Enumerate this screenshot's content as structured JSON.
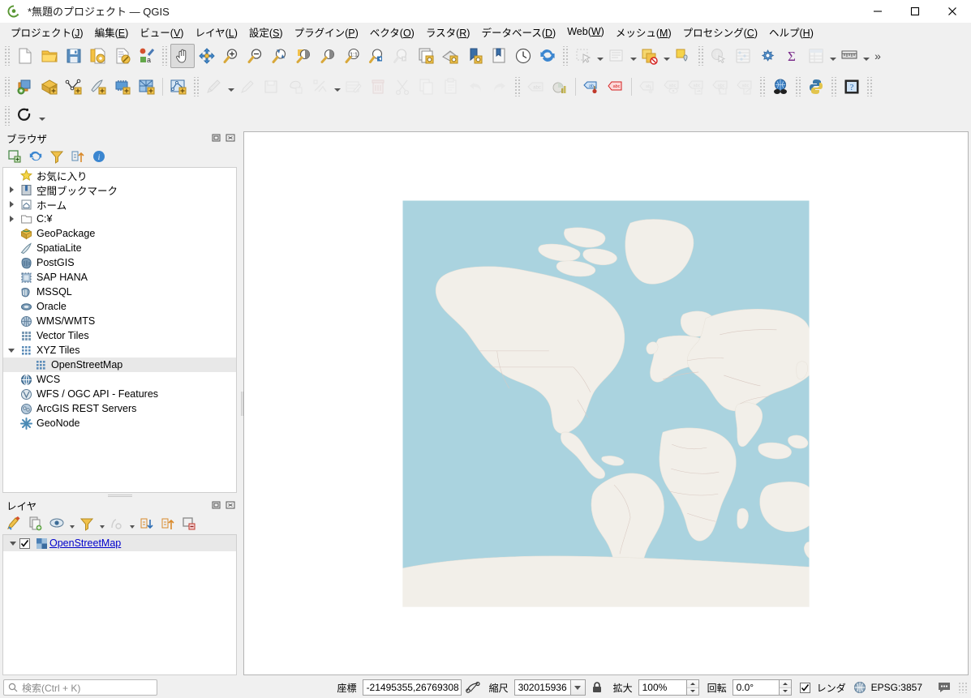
{
  "window": {
    "title": "*無題のプロジェクト — QGIS",
    "logo_icon": "qgis-logo-icon",
    "minimize_label": "—",
    "maximize_label": "□",
    "close_label": "✕"
  },
  "menubar": {
    "items": [
      {
        "label": "プロジェクト(J)",
        "name": "menu-project"
      },
      {
        "label": "編集(E)",
        "name": "menu-edit"
      },
      {
        "label": "ビュー(V)",
        "name": "menu-view"
      },
      {
        "label": "レイヤ(L)",
        "name": "menu-layer"
      },
      {
        "label": "設定(S)",
        "name": "menu-settings"
      },
      {
        "label": "プラグイン(P)",
        "name": "menu-plugins"
      },
      {
        "label": "ベクタ(O)",
        "name": "menu-vector"
      },
      {
        "label": "ラスタ(R)",
        "name": "menu-raster"
      },
      {
        "label": "データベース(D)",
        "name": "menu-database"
      },
      {
        "label": "Web(W)",
        "name": "menu-web"
      },
      {
        "label": "メッシュ(M)",
        "name": "menu-mesh"
      },
      {
        "label": "プロセシング(C)",
        "name": "menu-processing"
      },
      {
        "label": "ヘルプ(H)",
        "name": "menu-help"
      }
    ]
  },
  "toolbars": {
    "row1": [
      {
        "icon": "new-project-icon",
        "name": "new-project-button"
      },
      {
        "icon": "open-project-icon",
        "name": "open-project-button"
      },
      {
        "icon": "save-project-icon",
        "name": "save-project-button"
      },
      {
        "icon": "save-project-as-icon",
        "name": "save-project-as-button"
      },
      {
        "icon": "new-print-layout-icon",
        "name": "new-print-layout-button"
      },
      {
        "icon": "style-manager-icon",
        "name": "style-manager-button"
      },
      {
        "icon": "pan-map-icon",
        "name": "pan-map-button",
        "active": true
      },
      {
        "icon": "pan-to-selection-icon",
        "name": "pan-to-selection-button"
      },
      {
        "icon": "zoom-in-icon",
        "name": "zoom-in-button"
      },
      {
        "icon": "zoom-out-icon",
        "name": "zoom-out-button"
      },
      {
        "icon": "zoom-full-icon",
        "name": "zoom-full-button"
      },
      {
        "icon": "zoom-to-selection-icon",
        "name": "zoom-to-selection-button"
      },
      {
        "icon": "zoom-to-layer-icon",
        "name": "zoom-to-layer-button"
      },
      {
        "icon": "zoom-native-icon",
        "name": "zoom-native-button"
      },
      {
        "icon": "zoom-last-icon",
        "name": "zoom-last-button"
      },
      {
        "icon": "zoom-next-icon",
        "name": "zoom-next-button",
        "disabled": true
      },
      {
        "icon": "new-map-view-icon",
        "name": "new-map-view-button"
      },
      {
        "icon": "new-3d-map-view-icon",
        "name": "new-3d-map-view-button"
      },
      {
        "icon": "new-bookmark-icon",
        "name": "new-bookmark-button"
      },
      {
        "icon": "show-bookmarks-icon",
        "name": "show-bookmarks-button"
      },
      {
        "icon": "temporal-controller-icon",
        "name": "temporal-controller-button"
      },
      {
        "icon": "refresh-icon",
        "name": "refresh-button"
      },
      {
        "icon": "select-features-icon",
        "name": "select-features-button",
        "disabled": true
      },
      {
        "icon": "select-value-icon",
        "name": "select-by-value-button",
        "disabled": true
      },
      {
        "icon": "deselect-features-icon",
        "name": "deselect-features-button"
      },
      {
        "icon": "identify-features-icon",
        "name": "identify-features-button",
        "disabled": true
      },
      {
        "icon": "statistical-summary-icon",
        "name": "statistical-summary-button",
        "disabled": true
      },
      {
        "icon": "processing-toolbox-icon",
        "name": "processing-toolbox-button"
      },
      {
        "icon": "field-calculator-icon",
        "name": "field-calculator-button"
      },
      {
        "icon": "attribute-table-icon",
        "name": "open-attribute-table-button",
        "disabled": true
      },
      {
        "icon": "measure-line-icon",
        "name": "measure-button"
      }
    ],
    "row2": [
      {
        "icon": "add-layer-icon",
        "name": "open-data-source-manager-button"
      },
      {
        "icon": "add-raster-layer-icon",
        "name": "add-raster-layer-button"
      },
      {
        "icon": "add-vector-layer-icon",
        "name": "add-vector-layer-button"
      },
      {
        "icon": "add-delimited-text-icon",
        "name": "add-delimited-text-layer-button"
      },
      {
        "icon": "add-mesh-layer-icon",
        "name": "add-mesh-layer-button"
      },
      {
        "icon": "add-virtual-layer-icon",
        "name": "add-virtual-layer-button"
      },
      {
        "icon": "new-shapefile-icon",
        "name": "new-shapefile-layer-button"
      },
      {
        "icon": "current-edits-icon",
        "name": "current-edits-button",
        "disabled": true
      },
      {
        "icon": "toggle-editing-icon",
        "name": "toggle-editing-button",
        "disabled": true
      },
      {
        "icon": "save-layer-edits-icon",
        "name": "save-layer-edits-button",
        "disabled": true
      },
      {
        "icon": "add-feature-icon",
        "name": "add-feature-button",
        "disabled": true
      },
      {
        "icon": "vertex-tool-icon",
        "name": "vertex-tool-button",
        "disabled": true
      },
      {
        "icon": "modify-attributes-icon",
        "name": "modify-attributes-button",
        "disabled": true
      },
      {
        "icon": "delete-selected-icon",
        "name": "delete-selected-button",
        "disabled": true
      },
      {
        "icon": "cut-features-icon",
        "name": "cut-features-button",
        "disabled": true
      },
      {
        "icon": "copy-features-icon",
        "name": "copy-features-button",
        "disabled": true
      },
      {
        "icon": "paste-features-icon",
        "name": "paste-features-button",
        "disabled": true
      },
      {
        "icon": "undo-icon",
        "name": "undo-button",
        "disabled": true
      },
      {
        "icon": "redo-icon",
        "name": "redo-button",
        "disabled": true
      },
      {
        "icon": "label-icon",
        "name": "layer-labeling-button",
        "disabled": true
      },
      {
        "icon": "diagram-icon",
        "name": "layer-diagram-button"
      },
      {
        "icon": "pin-labels-icon",
        "name": "pin-labels-button"
      },
      {
        "icon": "highlight-labels-icon",
        "name": "highlight-labels-button"
      },
      {
        "icon": "move-label-icon",
        "name": "move-label-button",
        "disabled": true
      },
      {
        "icon": "show-hide-labels-icon",
        "name": "show-hide-labels-button",
        "disabled": true
      },
      {
        "icon": "rotate-label-icon",
        "name": "rotate-label-button",
        "disabled": true
      },
      {
        "icon": "change-label-icon",
        "name": "change-label-button",
        "disabled": true
      },
      {
        "icon": "edit-label-icon",
        "name": "edit-label-button",
        "disabled": true
      },
      {
        "icon": "metasearch-icon",
        "name": "metasearch-button"
      },
      {
        "icon": "python-console-icon",
        "name": "python-console-button"
      },
      {
        "icon": "help-icon",
        "name": "help-button"
      }
    ],
    "row3": [
      {
        "icon": "georeferencer-icon",
        "name": "georeferencer-button"
      }
    ]
  },
  "browser_panel": {
    "title": "ブラウザ",
    "undock_icon": "undock-icon",
    "close_icon": "close-icon",
    "toolbar": [
      {
        "icon": "add-layer-icon",
        "name": "add-selected-layers-button"
      },
      {
        "icon": "refresh-icon",
        "name": "refresh-browser-button"
      },
      {
        "icon": "filter-icon",
        "name": "filter-browser-button"
      },
      {
        "icon": "collapse-all-icon",
        "name": "collapse-all-button"
      },
      {
        "icon": "info-icon",
        "name": "show-properties-button"
      }
    ],
    "items": [
      {
        "label": "お気に入り",
        "icon": "star-icon",
        "twist": "none",
        "indent": 0
      },
      {
        "label": "空間ブックマーク",
        "icon": "bookmark-icon",
        "twist": "right",
        "indent": 0
      },
      {
        "label": "ホーム",
        "icon": "home-icon",
        "twist": "right",
        "indent": 0
      },
      {
        "label": "C:¥",
        "icon": "folder-icon",
        "twist": "right",
        "indent": 0
      },
      {
        "label": "GeoPackage",
        "icon": "geopackage-icon",
        "twist": "none",
        "indent": 0
      },
      {
        "label": "SpatiaLite",
        "icon": "spatialite-icon",
        "twist": "none",
        "indent": 0
      },
      {
        "label": "PostGIS",
        "icon": "postgis-icon",
        "twist": "none",
        "indent": 0
      },
      {
        "label": "SAP HANA",
        "icon": "saphana-icon",
        "twist": "none",
        "indent": 0
      },
      {
        "label": "MSSQL",
        "icon": "mssql-icon",
        "twist": "none",
        "indent": 0
      },
      {
        "label": "Oracle",
        "icon": "oracle-icon",
        "twist": "none",
        "indent": 0
      },
      {
        "label": "WMS/WMTS",
        "icon": "wms-icon",
        "twist": "none",
        "indent": 0
      },
      {
        "label": "Vector Tiles",
        "icon": "vectortiles-icon",
        "twist": "none",
        "indent": 0
      },
      {
        "label": "XYZ Tiles",
        "icon": "xyztiles-icon",
        "twist": "down",
        "indent": 0
      },
      {
        "label": "OpenStreetMap",
        "icon": "xyztiles-icon",
        "twist": "none",
        "indent": 1,
        "selected": true
      },
      {
        "label": "WCS",
        "icon": "wcs-icon",
        "twist": "none",
        "indent": 0
      },
      {
        "label": "WFS / OGC API - Features",
        "icon": "wfs-icon",
        "twist": "none",
        "indent": 0
      },
      {
        "label": "ArcGIS REST Servers",
        "icon": "arcgis-icon",
        "twist": "none",
        "indent": 0
      },
      {
        "label": "GeoNode",
        "icon": "geonode-icon",
        "twist": "none",
        "indent": 0
      }
    ]
  },
  "layers_panel": {
    "title": "レイヤ",
    "undock_icon": "undock-icon",
    "close_icon": "close-icon",
    "toolbar": [
      {
        "icon": "open-layer-styling-icon",
        "name": "open-layer-styling-button"
      },
      {
        "icon": "add-group-icon",
        "name": "add-group-button"
      },
      {
        "icon": "manage-visibility-icon",
        "name": "manage-map-themes-button"
      },
      {
        "icon": "filter-legend-icon",
        "name": "filter-legend-button"
      },
      {
        "icon": "edit-filter-icon",
        "name": "filter-legend-expression-button",
        "disabled": true
      },
      {
        "icon": "expand-all-icon",
        "name": "expand-all-button"
      },
      {
        "icon": "collapse-all-icon",
        "name": "collapse-all-button"
      },
      {
        "icon": "remove-layer-icon",
        "name": "remove-layer-button"
      }
    ],
    "layers": [
      {
        "label": "OpenStreetMap",
        "checked": true,
        "icon": "raster-layer-icon",
        "twist": "down"
      }
    ]
  },
  "statusbar": {
    "search_placeholder": "検索(Ctrl + K)",
    "search_icon": "search-icon",
    "coordinate_label": "座標",
    "coordinate_value": "-21495355,26769308",
    "toggle_extents_icon": "toggle-extents-icon",
    "scale_label": "縮尺",
    "scale_value": "302015936",
    "lock_icon": "lock-icon",
    "magnifier_label": "拡大",
    "magnifier_value": "100%",
    "rotation_label": "回転",
    "rotation_value": "0.0°",
    "render_label": "レンダ",
    "render_checked": true,
    "crs_icon": "crs-globe-icon",
    "crs_value": "EPSG:3857",
    "messages_icon": "messages-icon"
  },
  "map": {
    "ocean_color": "#aad3df",
    "land_color": "#f2efe9",
    "border_color": "#d6c8c2",
    "canvas_background": "#ffffff",
    "layer_name": "OpenStreetMap"
  }
}
